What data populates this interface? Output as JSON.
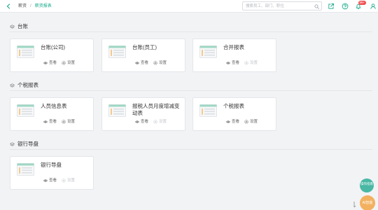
{
  "header": {
    "breadcrumb": {
      "parent": "薪资",
      "separator": "/",
      "current": "薪资报表"
    },
    "search_placeholder": "搜索员工、部门、职位",
    "notification_count": "99+"
  },
  "sections": [
    {
      "title": "台账",
      "cards": [
        {
          "title": "台账(公司)",
          "view_label": "查看",
          "settings_label": "设置",
          "settings_enabled": true
        },
        {
          "title": "台账(员工)",
          "view_label": "查看",
          "settings_label": "设置",
          "settings_enabled": true
        },
        {
          "title": "合并报表",
          "view_label": "查看",
          "settings_label": "设置",
          "settings_enabled": false
        }
      ]
    },
    {
      "title": "个税报表",
      "cards": [
        {
          "title": "人员信息表",
          "view_label": "查看",
          "settings_label": "设置",
          "settings_enabled": true
        },
        {
          "title": "报税人员月度增减变动表",
          "view_label": "查看",
          "settings_label": "设置",
          "settings_enabled": false
        },
        {
          "title": "个税报表",
          "view_label": "查看",
          "settings_label": "设置",
          "settings_enabled": true
        }
      ]
    },
    {
      "title": "银行导盘",
      "cards": [
        {
          "title": "银行导盘",
          "view_label": "查看",
          "settings_label": "设置",
          "settings_enabled": false
        }
      ]
    }
  ],
  "floating": {
    "help_label": "操作指南",
    "avatar_label": "AI智能"
  },
  "colors": {
    "accent": "#1aab8a",
    "badge": "#f04b4b",
    "disabled": "#c4c7cc",
    "help_button": "#49b8a4",
    "avatar": "#f3b15f"
  },
  "icons": [
    "back-arrow-icon",
    "search-icon",
    "external-link-icon",
    "help-circle-icon",
    "bell-icon",
    "user-icon",
    "layers-icon",
    "report-thumbnail-icon",
    "eye-icon",
    "gear-icon"
  ]
}
